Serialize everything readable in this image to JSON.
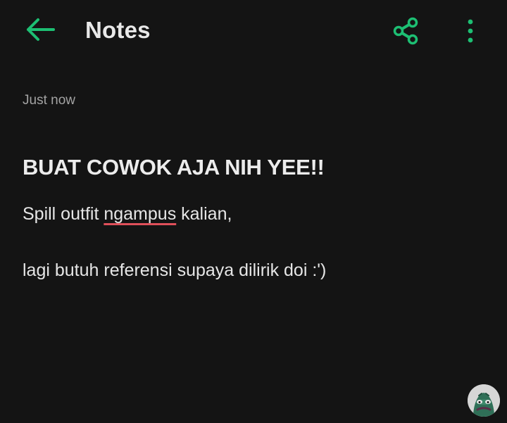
{
  "app": {
    "title": "Notes",
    "accent_color": "#1dbf73"
  },
  "toolbar": {
    "back_icon": "arrow-left-icon",
    "share_icon": "share-icon",
    "more_icon": "more-vertical-icon"
  },
  "note": {
    "timestamp": "Just now",
    "title": "BUAT COWOK AJA NIH YEE!!",
    "line1_before": "Spill outfit ",
    "line1_misspelled": "ngampus",
    "line1_after": " kalian,",
    "line3": "lagi butuh referensi supaya dilirik doi :')"
  },
  "avatar": {
    "icon": "avatar-character-icon"
  }
}
